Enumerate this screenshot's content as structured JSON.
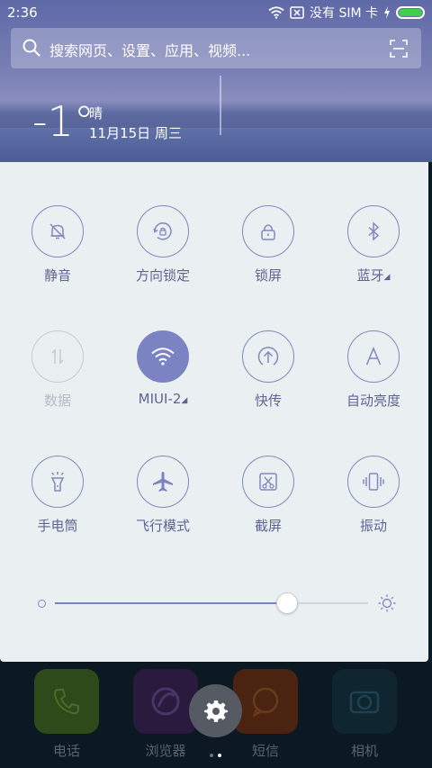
{
  "status_bar": {
    "time": "2:36",
    "carrier": "没有 SIM 卡"
  },
  "search": {
    "placeholder": "搜索网页、设置、应用、视频..."
  },
  "weather": {
    "temperature": "-1°",
    "condition": "晴",
    "date": "11月15日 周三"
  },
  "quick_settings": {
    "tiles": [
      {
        "label": "静音",
        "icon": "bell-mute-icon",
        "state": "off"
      },
      {
        "label": "方向锁定",
        "icon": "rotation-lock-icon",
        "state": "off"
      },
      {
        "label": "锁屏",
        "icon": "lock-icon",
        "state": "off"
      },
      {
        "label": "蓝牙",
        "icon": "bluetooth-icon",
        "state": "off",
        "has_dropdown": true
      },
      {
        "label": "数据",
        "icon": "mobile-data-icon",
        "state": "disabled"
      },
      {
        "label": "MIUI-2",
        "icon": "wifi-icon",
        "state": "on",
        "has_dropdown": true
      },
      {
        "label": "快传",
        "icon": "transfer-icon",
        "state": "off"
      },
      {
        "label": "自动亮度",
        "icon": "auto-brightness-icon",
        "state": "off"
      },
      {
        "label": "手电筒",
        "icon": "flashlight-icon",
        "state": "off"
      },
      {
        "label": "飞行模式",
        "icon": "airplane-icon",
        "state": "off"
      },
      {
        "label": "截屏",
        "icon": "screenshot-icon",
        "state": "off"
      },
      {
        "label": "振动",
        "icon": "vibrate-icon",
        "state": "off"
      }
    ],
    "brightness_level": 0.74
  },
  "dock": {
    "apps": [
      {
        "label": "电话",
        "icon": "phone-icon",
        "color": "#2f4a1a"
      },
      {
        "label": "浏览器",
        "icon": "browser-icon",
        "color": "#2a1a3e"
      },
      {
        "label": "短信",
        "icon": "message-icon",
        "color": "#4a2410"
      },
      {
        "label": "相机",
        "icon": "camera-icon",
        "color": "#0f2630"
      }
    ]
  },
  "colors": {
    "accent": "#7c83c3",
    "panel_bg": "#eaeff2",
    "tile_text": "#5e6594"
  }
}
